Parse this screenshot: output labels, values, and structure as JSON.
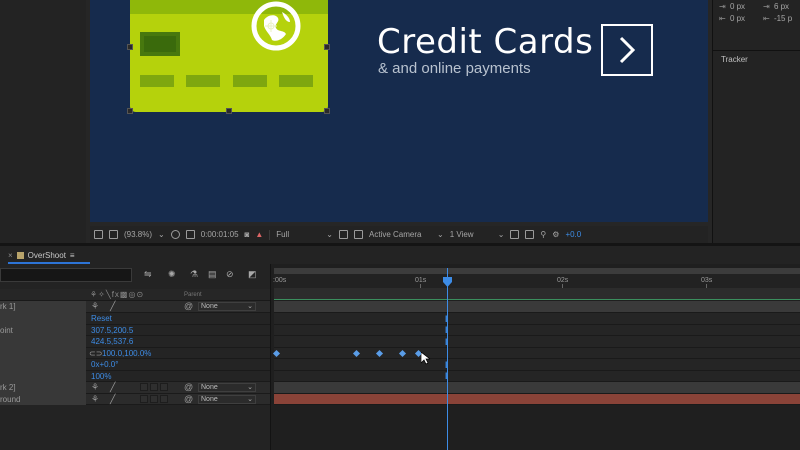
{
  "composition": {
    "title": "Credit Cards",
    "subtitle": "& and online payments",
    "colors": {
      "background": "#162b4d",
      "card": "#b5d20c",
      "card_band": "#8fb80a",
      "chip": "#47780e"
    }
  },
  "comp_toolbar": {
    "zoom": "(93.8%)",
    "timecode": "0:00:01:05",
    "resolution": "Full",
    "view": "Active Camera",
    "views_count": "1 View",
    "exposure": "+0.0"
  },
  "right_panel": {
    "values": [
      "0 px",
      "6 px",
      "0 px",
      "-15 p"
    ],
    "tracker_label": "Tracker"
  },
  "timeline": {
    "tab_name": "OverShoot",
    "tab_menu_icon": "≡",
    "parent_header": "Parent",
    "time_labels": [
      ":00s",
      "01s",
      "02s",
      "03s"
    ],
    "layers": [
      {
        "name": "rk 1]",
        "parent": "None"
      },
      {
        "name": "rk 2]",
        "parent": "None"
      },
      {
        "name": "round",
        "parent": "None"
      }
    ],
    "properties": [
      {
        "label": "",
        "value": "Reset"
      },
      {
        "label": "oint",
        "value": "307.5,200.5"
      },
      {
        "label": "",
        "value": "424.5,537.6"
      },
      {
        "label": "",
        "value": "100.0,100.0%"
      },
      {
        "label": "",
        "value": "0x+0.0°"
      },
      {
        "label": "",
        "value": "100%"
      }
    ]
  }
}
